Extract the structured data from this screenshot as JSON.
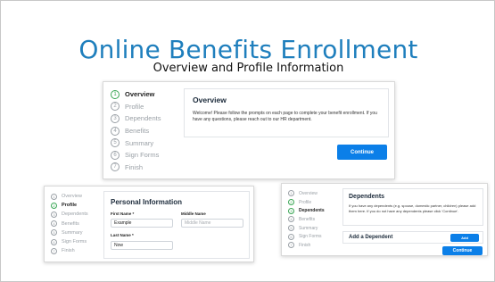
{
  "slide": {
    "title": "Online Benefits Enrollment",
    "subtitle": "Overview and Profile Information"
  },
  "colors": {
    "title": "#1f7fbd",
    "accent": "#0b7fe8",
    "step_active": "#3aa655"
  },
  "overview": {
    "steps": [
      {
        "num": "1",
        "label": "Overview"
      },
      {
        "num": "2",
        "label": "Profile"
      },
      {
        "num": "3",
        "label": "Dependents"
      },
      {
        "num": "4",
        "label": "Benefits"
      },
      {
        "num": "5",
        "label": "Summary"
      },
      {
        "num": "6",
        "label": "Sign Forms"
      },
      {
        "num": "7",
        "label": "Finish"
      }
    ],
    "card_title": "Overview",
    "card_text": "Welcome! Please follow the prompts on each page to complete your benefit enrollment. If you have any questions, please reach out to our HR department.",
    "continue_label": "Continue"
  },
  "profile": {
    "steps": [
      {
        "num": "1",
        "label": "Overview"
      },
      {
        "num": "2",
        "label": "Profile"
      },
      {
        "num": "3",
        "label": "Dependents"
      },
      {
        "num": "4",
        "label": "Benefits"
      },
      {
        "num": "5",
        "label": "Summary"
      },
      {
        "num": "6",
        "label": "Sign Forms"
      },
      {
        "num": "7",
        "label": "Finish"
      }
    ],
    "section_title": "Personal Information",
    "first_name_label": "First Name *",
    "first_name_value": "Example",
    "middle_name_label": "Middle Name",
    "middle_name_placeholder": "Middle Name",
    "last_name_label": "Last Name *",
    "last_name_value": "Now"
  },
  "dependents": {
    "steps": [
      {
        "num": "1",
        "label": "Overview"
      },
      {
        "num": "2",
        "label": "Profile"
      },
      {
        "num": "3",
        "label": "Dependents"
      },
      {
        "num": "4",
        "label": "Benefits"
      },
      {
        "num": "5",
        "label": "Summary"
      },
      {
        "num": "6",
        "label": "Sign Forms"
      },
      {
        "num": "7",
        "label": "Finish"
      }
    ],
    "card_title": "Dependents",
    "card_text": "If you have any dependents (e.g. spouse, domestic partner, children) please add them here. If you do not have any dependents please click 'Continue'.",
    "add_label": "Add a Dependent",
    "add_button": "Add",
    "continue_label": "Continue"
  }
}
